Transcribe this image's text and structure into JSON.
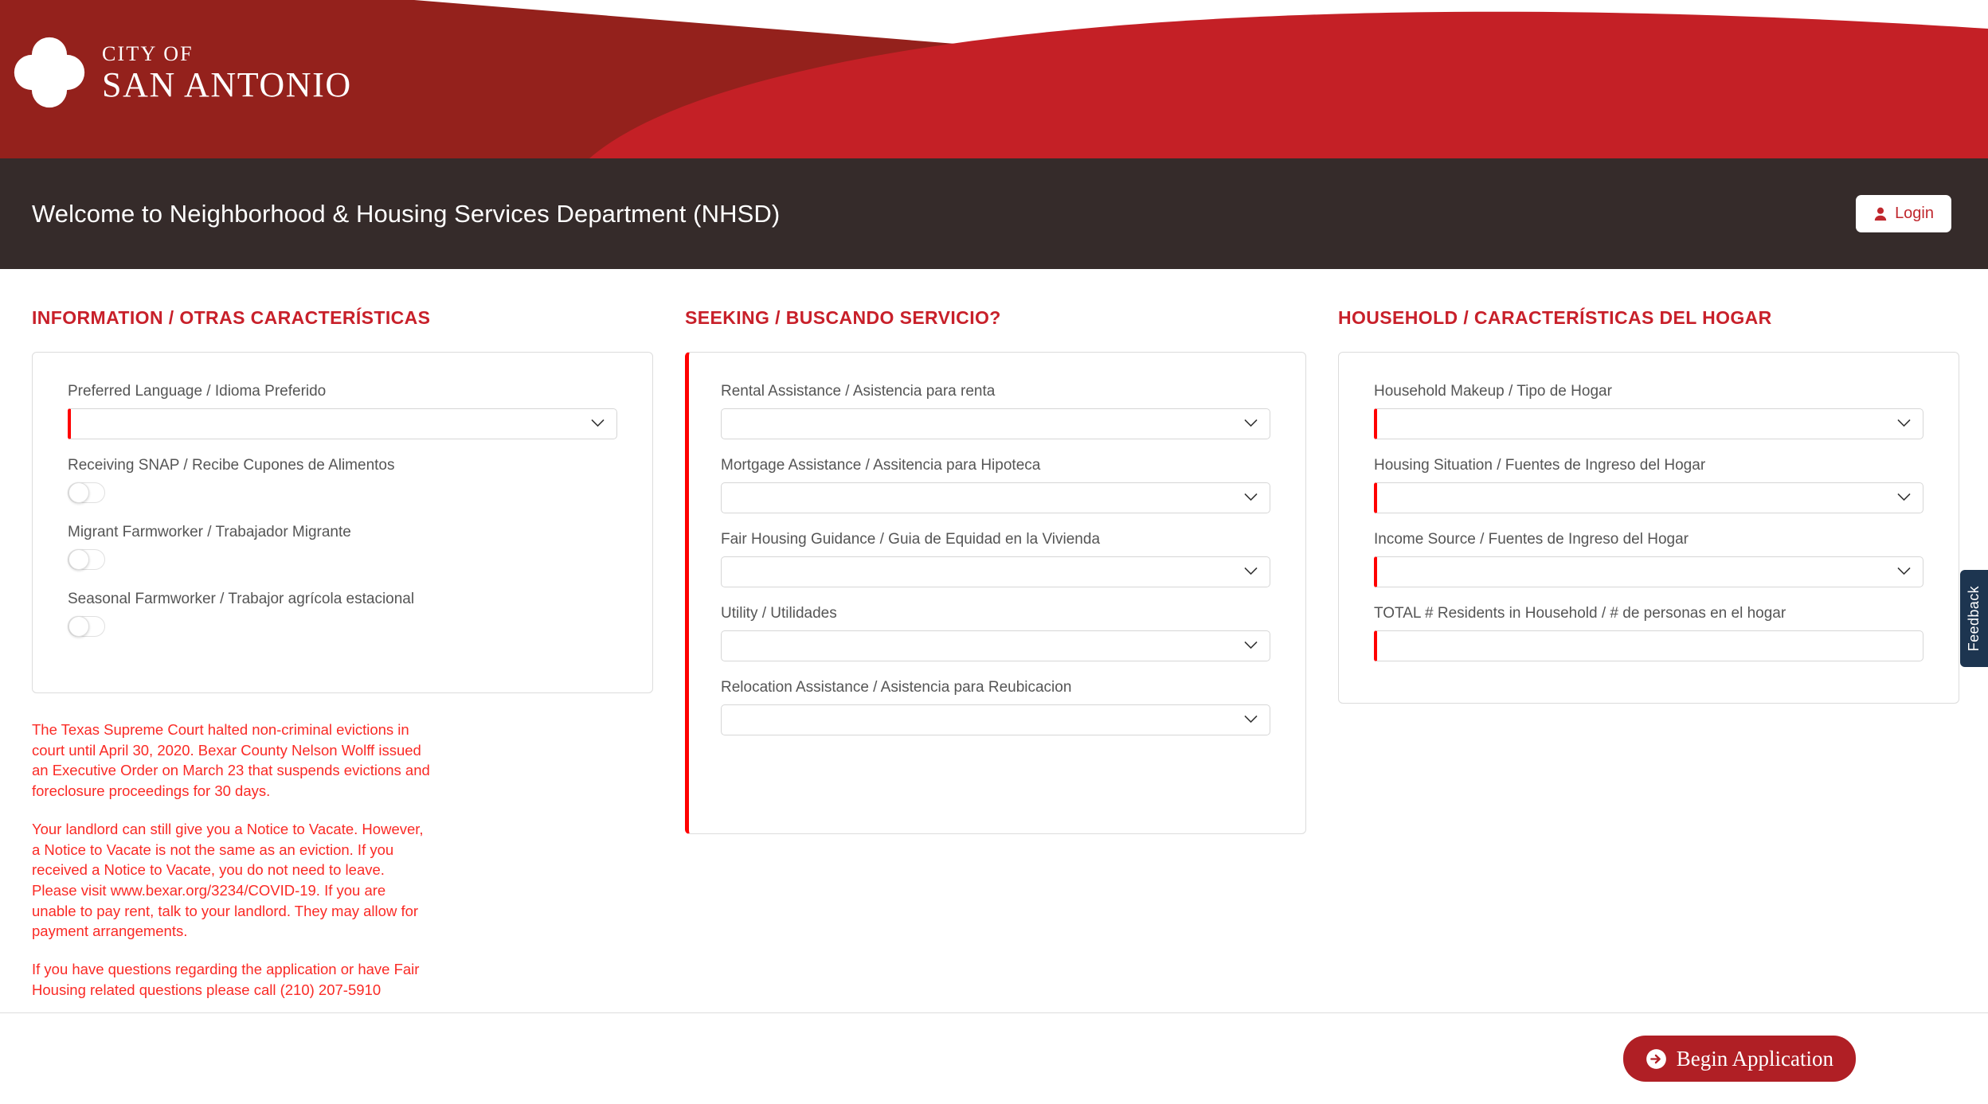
{
  "brand": {
    "logo_line1": "CITY OF",
    "logo_line2": "SAN ANTONIO",
    "logo_icon": "quatrefoil-icon",
    "color_dark_red": "#94211c",
    "color_bright_red": "#c42026",
    "color_heading_red": "#c8202a",
    "color_welcome_bar": "#352b2a",
    "color_required_red": "#ff0000",
    "color_notice_red": "#fa2a25",
    "color_feedback_navy": "#1d3550",
    "color_begin_button": "#b01f25"
  },
  "welcome": {
    "title": "Welcome to Neighborhood & Housing Services Department (NHSD)",
    "login_label": "Login",
    "login_icon": "user-icon"
  },
  "columns": {
    "information": {
      "heading": "INFORMATION / OTRAS CARACTERÍSTICAS",
      "fields": [
        {
          "label": "Preferred Language / Idioma Preferido",
          "type": "select",
          "value": "",
          "required": true
        },
        {
          "label": "Receiving SNAP / Recibe Cupones de Alimentos",
          "type": "toggle",
          "value": "off"
        },
        {
          "label": "Migrant Farmworker / Trabajador Migrante",
          "type": "toggle",
          "value": "off"
        },
        {
          "label": "Seasonal Farmworker / Trabajor agrícola estacional",
          "type": "toggle",
          "value": "off"
        }
      ],
      "notices": [
        "The Texas Supreme Court halted non-criminal evictions in court until April 30, 2020. Bexar County Nelson Wolff issued an Executive Order on March 23 that suspends evictions and foreclosure proceedings for 30 days.",
        "Your landlord can still give you a Notice to Vacate. However, a Notice to Vacate is not the same as an eviction. If you received a Notice to Vacate, you do not need to leave. Please visit www.bexar.org/3234/COVID-19. If you are unable to pay rent, talk to your landlord. They may allow for payment arrangements.",
        "If you have questions regarding the application or have Fair Housing related questions please call (210) 207-5910"
      ]
    },
    "seeking": {
      "heading": "SEEKING / BUSCANDO SERVICIO?",
      "card_required": true,
      "fields": [
        {
          "label": "Rental Assistance / Asistencia para renta",
          "type": "select",
          "value": ""
        },
        {
          "label": "Mortgage Assistance / Assitencia para Hipoteca",
          "type": "select",
          "value": ""
        },
        {
          "label": "Fair Housing Guidance / Guia de Equidad en la Vivienda",
          "type": "select",
          "value": ""
        },
        {
          "label": "Utility / Utilidades",
          "type": "select",
          "value": ""
        },
        {
          "label": "Relocation Assistance / Asistencia para Reubicacion",
          "type": "select",
          "value": ""
        }
      ]
    },
    "household": {
      "heading": "HOUSEHOLD / CARACTERÍSTICAS DEL HOGAR",
      "fields": [
        {
          "label": "Household Makeup / Tipo de Hogar",
          "type": "select",
          "value": "",
          "required": true
        },
        {
          "label": "Housing Situation / Fuentes de Ingreso del Hogar",
          "type": "select",
          "value": "",
          "required": true
        },
        {
          "label": "Income Source / Fuentes de Ingreso del Hogar",
          "type": "select",
          "value": "",
          "required": true
        },
        {
          "label": "TOTAL # Residents in Household / # de personas en el hogar",
          "type": "text",
          "value": "",
          "required": true
        }
      ]
    }
  },
  "feedback": {
    "label": "Feedback"
  },
  "footer": {
    "begin_label": "Begin Application",
    "begin_icon": "arrow-circle-right-icon"
  }
}
